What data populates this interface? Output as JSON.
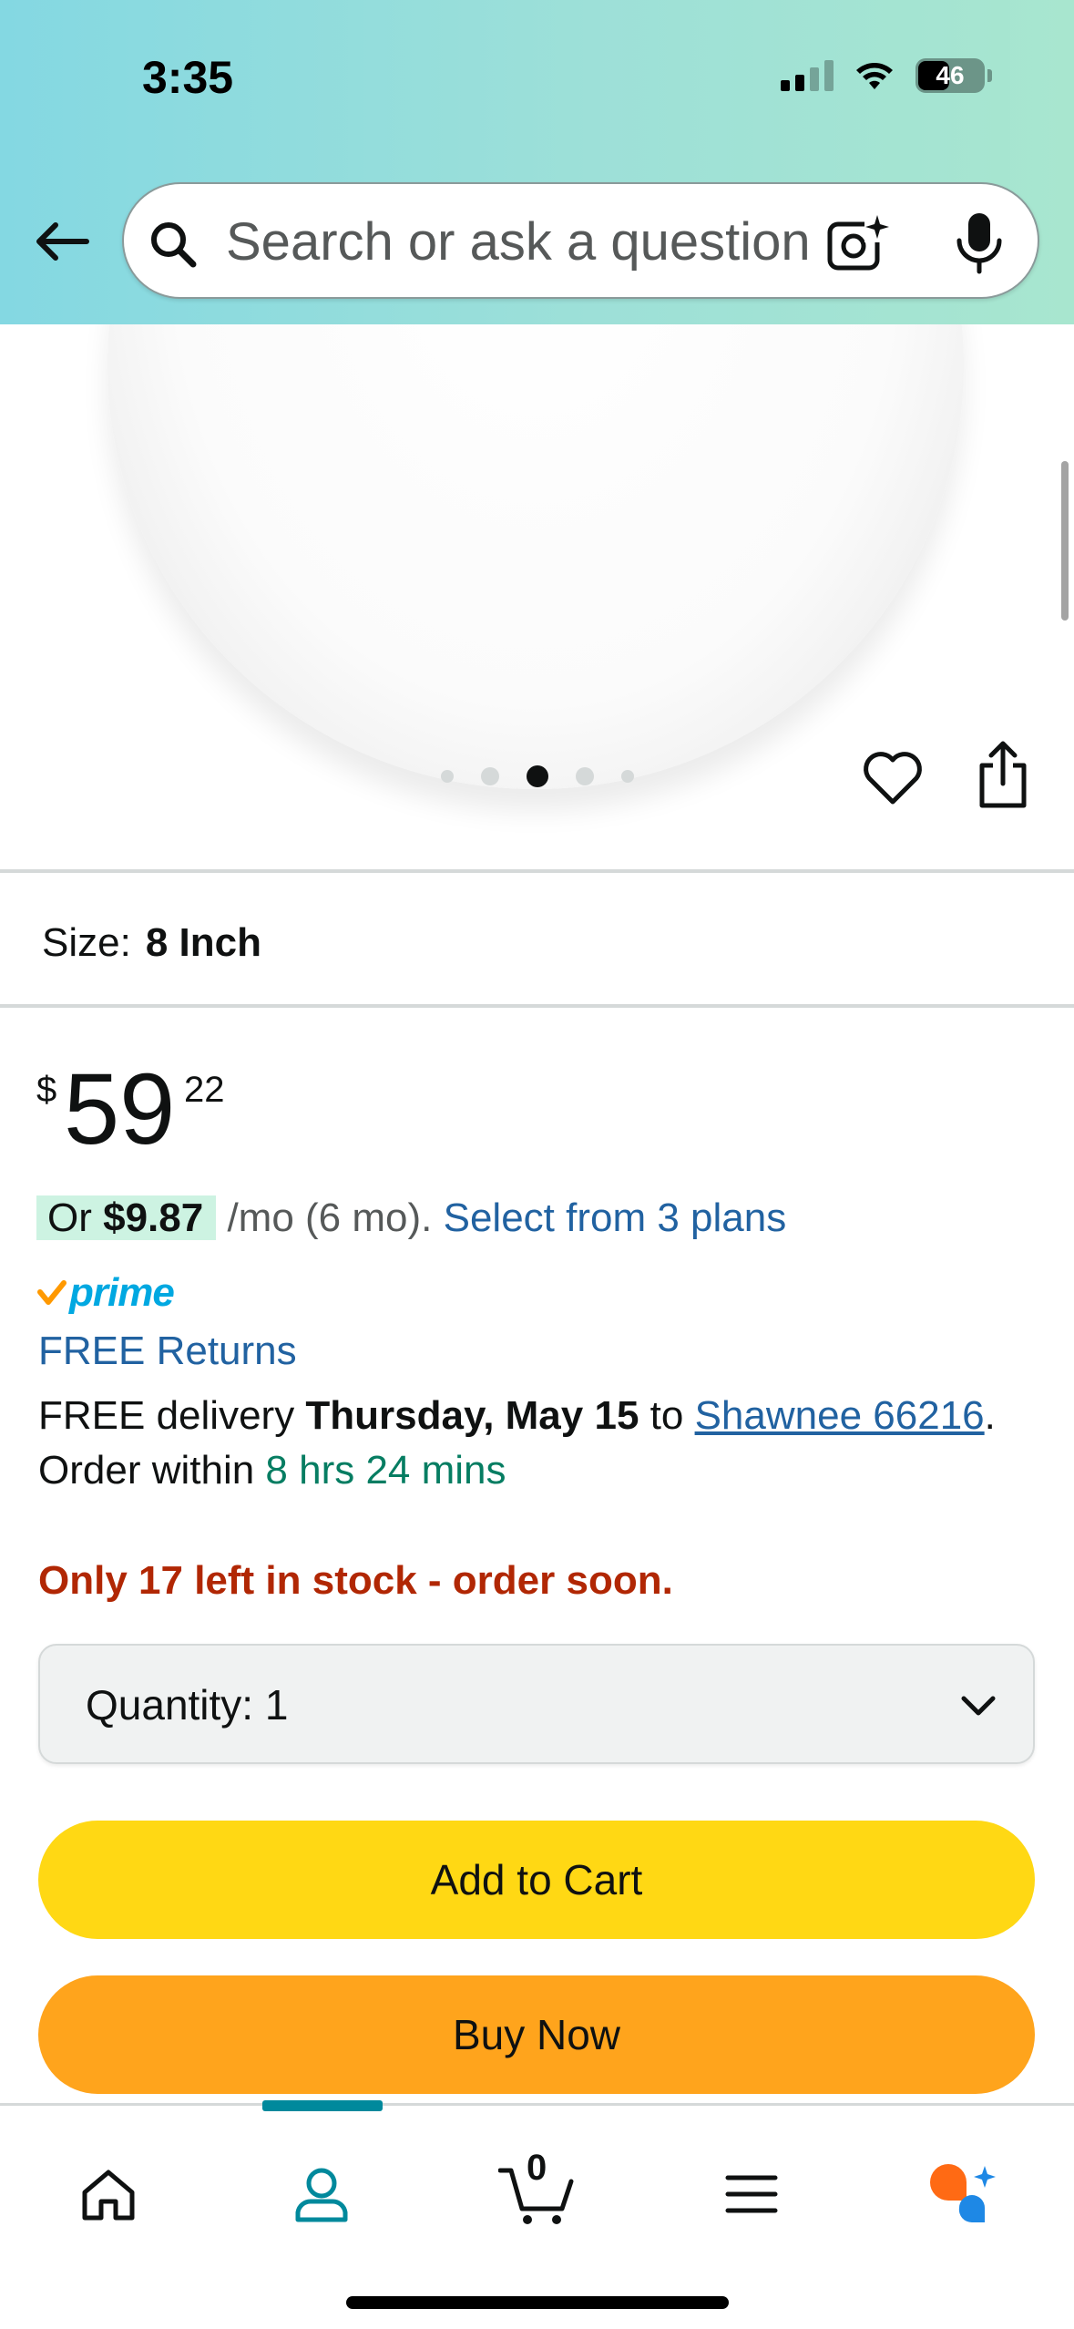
{
  "status_bar": {
    "time": "3:35",
    "battery": "46"
  },
  "search": {
    "placeholder": "Search or ask a question"
  },
  "gallery": {
    "dot_count": 5,
    "active_index": 2
  },
  "size": {
    "label": "Size:",
    "value": "8 Inch"
  },
  "price": {
    "currency": "$",
    "whole": "59",
    "fraction": "22"
  },
  "installment": {
    "prefix": "Or ",
    "amount": "$9.87",
    "term": " /mo (6 mo). ",
    "plans_link": "Select from 3 plans"
  },
  "prime": {
    "label": "prime"
  },
  "returns": {
    "label": "FREE Returns"
  },
  "delivery": {
    "prefix": "FREE delivery ",
    "date": "Thursday, May 15",
    "to": " to ",
    "address": "Shawnee 66216",
    "order_within": ". Order within ",
    "countdown": "8 hrs 24 mins"
  },
  "stock": {
    "message": "Only 17 left in stock - order soon."
  },
  "quantity": {
    "label": "Quantity:",
    "value": "1"
  },
  "buttons": {
    "add_to_cart": "Add to Cart",
    "buy_now": "Buy Now"
  },
  "bottom_nav": {
    "cart_count": "0",
    "active_tab": "account"
  },
  "colors": {
    "add_to_cart": "#ffd814",
    "buy_now": "#ffa41c",
    "link": "#2162a1",
    "stock_warning": "#b12704",
    "countdown": "#067d62",
    "prime_blue": "#00a8e1",
    "nav_accent": "#00899c"
  }
}
